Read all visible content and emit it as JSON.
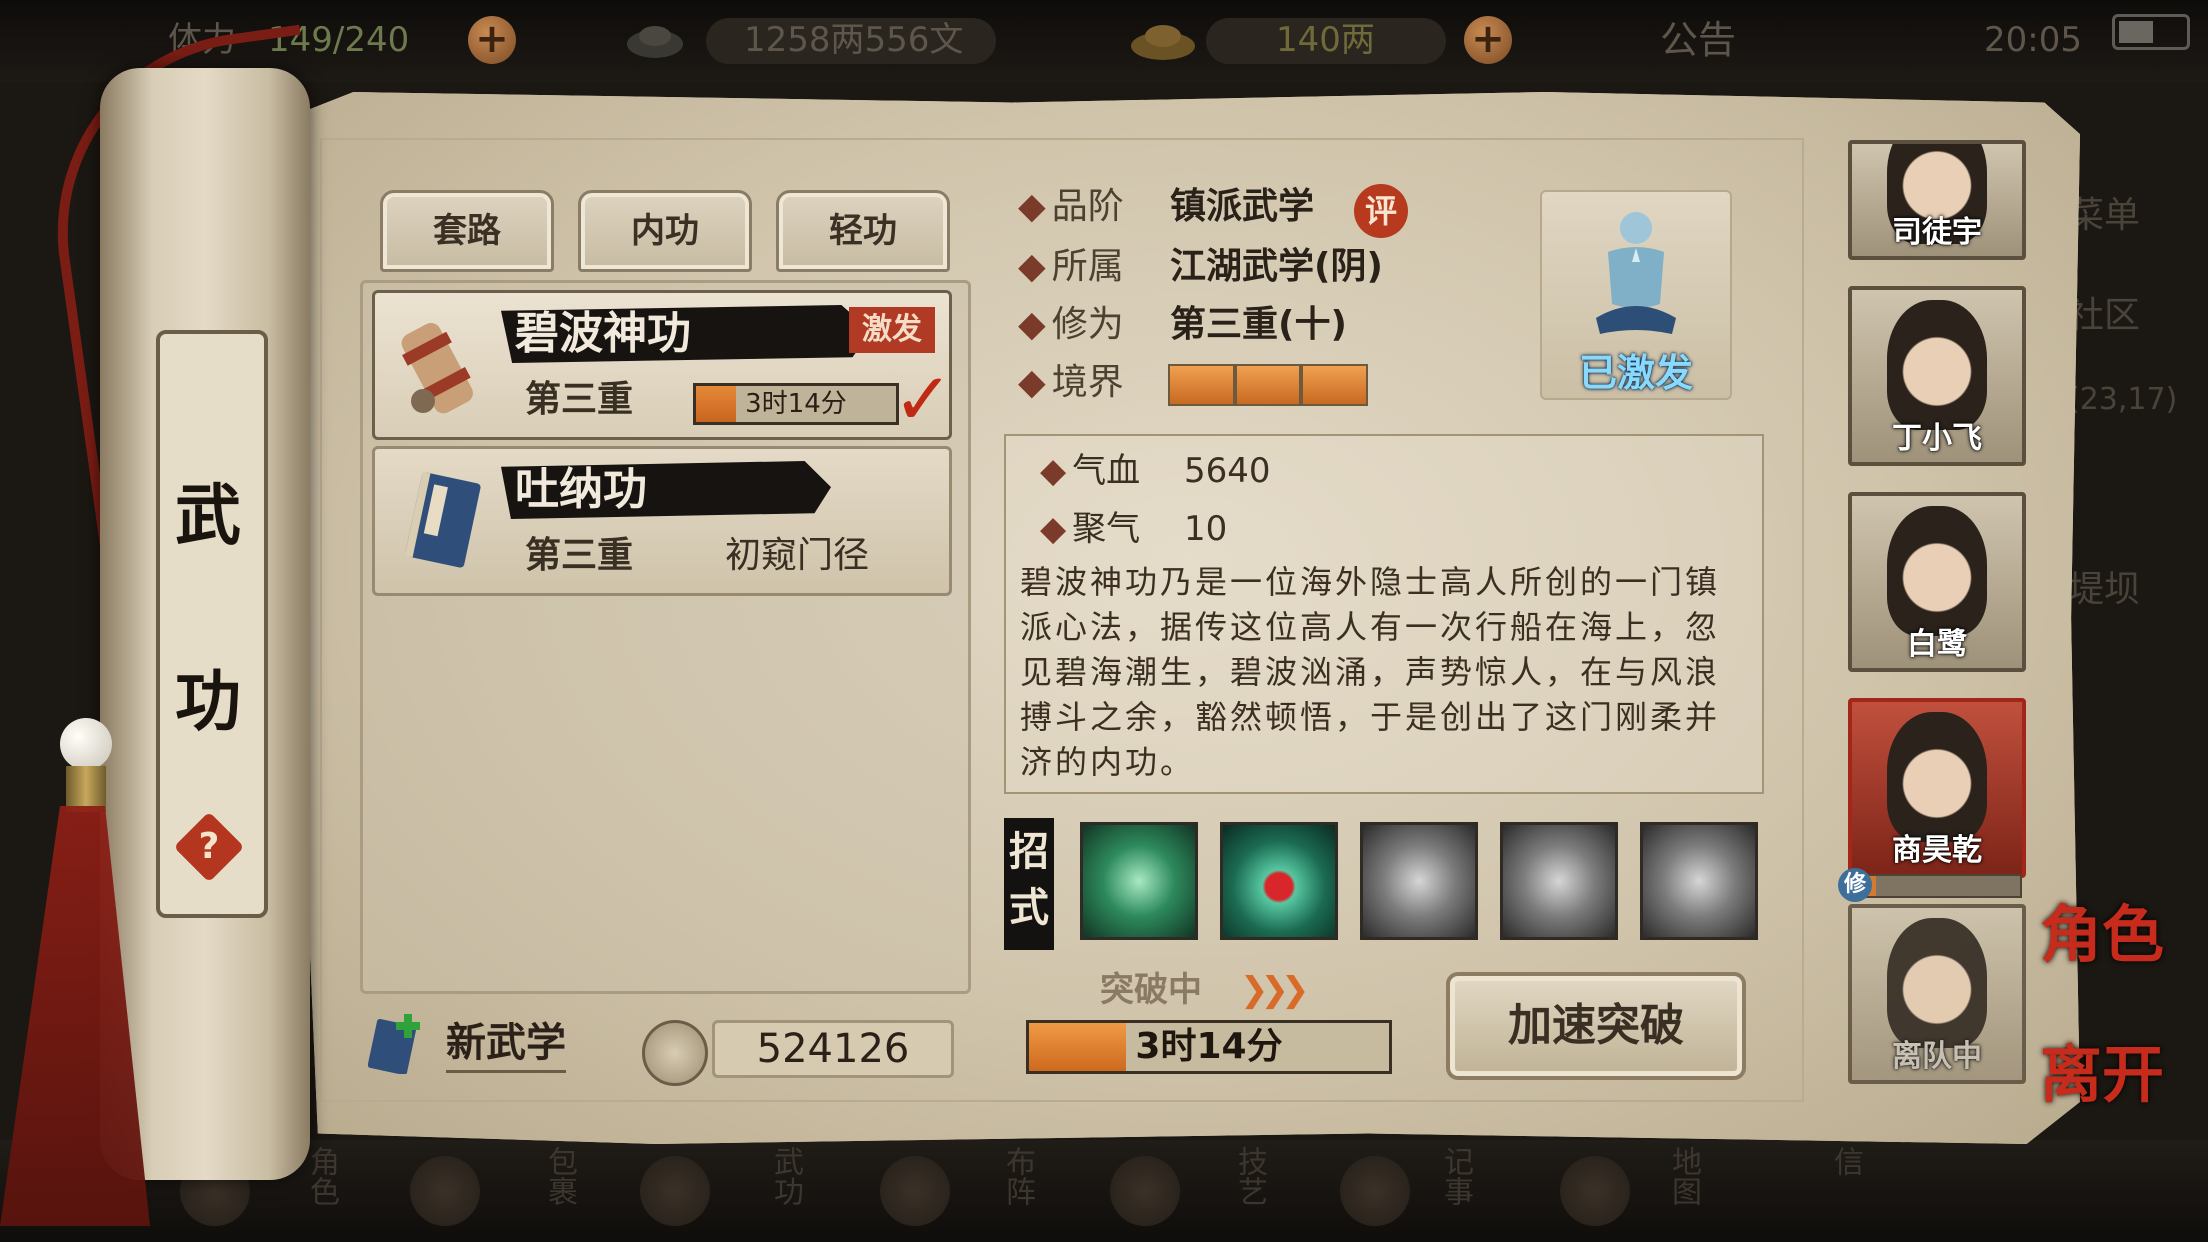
{
  "topbar": {
    "stamina_label": "体力",
    "stamina_value": "149/240",
    "silver": "1258两556文",
    "gold": "140两",
    "notice": "公告",
    "time": "20:05"
  },
  "background_menu": {
    "items": [
      "菜单",
      "社区",
      "(23,17)",
      "堤坝"
    ]
  },
  "bottom_nav": {
    "items": [
      "角色",
      "包裹",
      "武功",
      "布阵",
      "技艺",
      "记事",
      "地图",
      "信"
    ]
  },
  "scroll": {
    "title_chars": [
      "武",
      "功"
    ],
    "help_icon": "question-icon"
  },
  "tabs": [
    {
      "label": "套路"
    },
    {
      "label": "内功"
    },
    {
      "label": "轻功"
    }
  ],
  "skills": [
    {
      "name": "碧波神功",
      "level": "第三重",
      "tag": "激发",
      "timer": "3时14分",
      "timer_progress": 0.2,
      "selected": true
    },
    {
      "name": "吐纳功",
      "level": "第三重",
      "status": "初窥门径",
      "selected": false
    }
  ],
  "footer_left": {
    "new_skill": "新武学",
    "points": "524126"
  },
  "detail": {
    "rank_label": "品阶",
    "rank_value": "镇派武学",
    "rank_badge": "评",
    "belong_label": "所属",
    "belong_value": "江湖武学(阴)",
    "cultivation_label": "修为",
    "cultivation_value": "第三重(十)",
    "realm_label": "境界",
    "realm_segments": 3,
    "portrait_status": "已激发",
    "hp_label": "气血",
    "hp_value": "5640",
    "qi_label": "聚气",
    "qi_value": "10",
    "description": "碧波神功乃是一位海外隐士高人所创的一门镇派心法，据传这位高人有一次行船在海上，忽见碧海潮生，碧波汹涌，声势惊人，在与风浪搏斗之余，豁然顿悟，于是创出了这门刚柔并济的内功。",
    "moves_label": "招式",
    "moves": [
      "green-aura-move-icon",
      "blood-drop-move-icon",
      "whirlwind-move-icon",
      "whirlwind-move-icon-2",
      "whirlwind-move-icon-3"
    ],
    "breakthrough_label": "突破中",
    "breakthrough_timer": "3时14分",
    "breakthrough_progress": 0.27,
    "speedup_button": "加速突破"
  },
  "party": [
    {
      "name": "司徒宇",
      "active": false
    },
    {
      "name": "丁小飞",
      "active": false
    },
    {
      "name": "白鹭",
      "active": false
    },
    {
      "name": "商昊乾",
      "active": true,
      "cultivation_progress": 0.15
    },
    {
      "name": "离队中",
      "active": false,
      "dim": true
    }
  ],
  "party_xiu_label": "修",
  "side_actions": {
    "role": "角色",
    "leave": "离开"
  },
  "colors": {
    "accent_red": "#b03a23",
    "progress_orange": "#e5893a",
    "activated_blue": "#89d9ff"
  }
}
